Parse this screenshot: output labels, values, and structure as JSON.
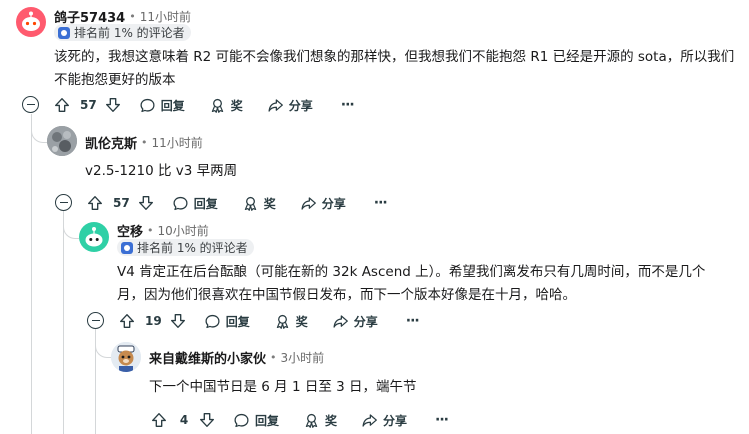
{
  "comments": [
    {
      "author": "鸽子57434",
      "time": "11小时前",
      "badge": "排名前 1% 的评论者",
      "text_line1": "该死的，我想这意味着 R2 可能不会像我们想象的那样快，但我想我们不能抱怨 R1 已经是开源的 sota，所以我们",
      "text_line2": "不能抱怨更好的版本",
      "votes": "57",
      "reply": "回复",
      "award": "奖",
      "share": "分享",
      "more": "···"
    },
    {
      "author": "凯伦克斯",
      "time": "11小时前",
      "text_line1": "v2.5-1210 比 v3 早两周",
      "votes": "57",
      "reply": "回复",
      "award": "奖",
      "share": "分享",
      "more": "···"
    },
    {
      "author": "空移",
      "time": "10小时前",
      "badge": "排名前 1% 的评论者",
      "text_line1": "V4 肯定正在后台酝酿（可能在新的 32k Ascend 上）。希望我们离发布只有几周时间，而不是几个",
      "text_line2": "月，因为他们很喜欢在中国节假日发布，而下一个版本好像是在十月，哈哈。",
      "votes": "19",
      "reply": "回复",
      "award": "奖",
      "share": "分享",
      "more": "···"
    },
    {
      "author": "来自戴维斯的小家伙",
      "time": "3小时前",
      "text_line1": "下一个中国节日是 6 月 1 日至 3 日，端午节",
      "votes": "4",
      "reply": "回复",
      "award": "奖",
      "share": "分享",
      "more": "···"
    }
  ],
  "separator": "•"
}
